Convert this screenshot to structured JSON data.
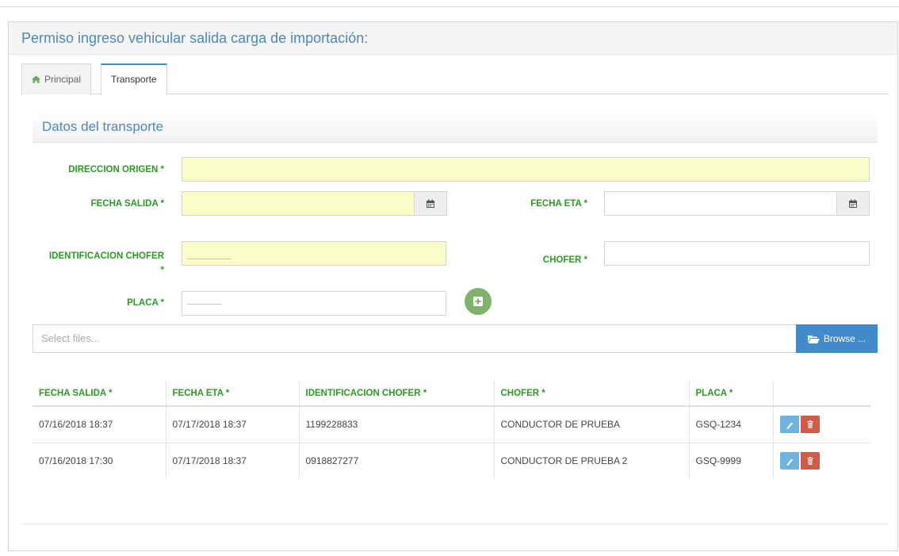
{
  "panel": {
    "title": "Permiso ingreso vehicular salida carga de importación:"
  },
  "tabs": [
    {
      "label": "Principal",
      "icon": "home-icon"
    },
    {
      "label": "Transporte"
    }
  ],
  "section": {
    "title": "Datos del transporte"
  },
  "form": {
    "direccion_origen": {
      "label": "DIRECCION ORIGEN *",
      "value": ""
    },
    "fecha_salida": {
      "label": "FECHA SALIDA *",
      "value": "",
      "icon": "calendar-icon"
    },
    "fecha_eta": {
      "label": "FECHA ETA *",
      "value": "",
      "icon": "calendar-icon"
    },
    "identificacion_chofer": {
      "label": "IDENTIFICACION CHOFER",
      "label_star": "*",
      "value": ""
    },
    "chofer": {
      "label": "CHOFER *",
      "value": ""
    },
    "placa": {
      "label": "PLACA *",
      "value": ""
    }
  },
  "files": {
    "placeholder": "Select files...",
    "browse_label": "Browse ..."
  },
  "table": {
    "headers": [
      "FECHA SALIDA *",
      "FECHA ETA *",
      "IDENTIFICACION CHOFER *",
      "CHOFER *",
      "PLACA *",
      ""
    ],
    "rows": [
      [
        "07/16/2018 18:37",
        "07/17/2018 18:37",
        "1199228833",
        "CONDUCTOR DE PRUEBA",
        "GSQ-1234"
      ],
      [
        "07/16/2018 17:30",
        "07/17/2018 18:37",
        "0918827277",
        "CONDUCTOR DE PRUEBA 2",
        "GSQ-9999"
      ]
    ]
  },
  "colors": {
    "label_green": "#2b9a23",
    "title_blue": "#4d88b8",
    "required_yellow": "#fbfdc6",
    "browse_blue": "#428bca",
    "edit_blue": "#6fb3e0",
    "delete_red": "#d15b47",
    "add_green": "#7fb36b"
  }
}
